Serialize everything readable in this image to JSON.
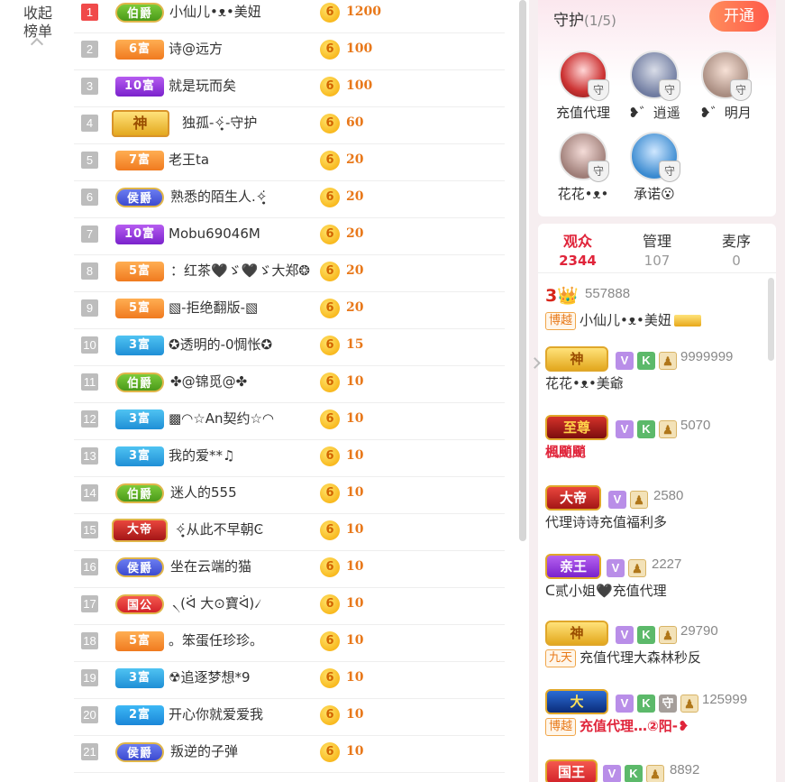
{
  "collapse": {
    "label": "收起榜单"
  },
  "ranking": [
    {
      "rank": "1",
      "badge": "伯爵",
      "name": "小仙儿•ᴥ•美妞",
      "score": "1200"
    },
    {
      "rank": "2",
      "badge": "6富",
      "name": "诗@远方",
      "score": "100"
    },
    {
      "rank": "3",
      "badge": "10富",
      "name": "就是玩而矣",
      "score": "100"
    },
    {
      "rank": "4",
      "badge": "神",
      "name": "独孤-✧̣̥̇-守护",
      "score": "60"
    },
    {
      "rank": "5",
      "badge": "7富",
      "name": "老王ta",
      "score": "20"
    },
    {
      "rank": "6",
      "badge": "侯爵",
      "name": "熟悉的陌生人.✧̣̥̇",
      "score": "20"
    },
    {
      "rank": "7",
      "badge": "10富",
      "name": "Mobu69046M",
      "score": "20"
    },
    {
      "rank": "8",
      "badge": "5富",
      "name": "：红茶🖤ゞ🖤ゞ大郑❂",
      "score": "20"
    },
    {
      "rank": "9",
      "badge": "5富",
      "name": "▧-拒绝翻版-▧",
      "score": "20"
    },
    {
      "rank": "10",
      "badge": "3富",
      "name": "✪透明的-0惆怅✪",
      "score": "15"
    },
    {
      "rank": "11",
      "badge": "伯爵",
      "name": "✤@锦觅@✤",
      "score": "10"
    },
    {
      "rank": "12",
      "badge": "3富",
      "name": "▩◠☆An契约☆◠",
      "score": "10"
    },
    {
      "rank": "13",
      "badge": "3富",
      "name": "我的爱**♫",
      "score": "10"
    },
    {
      "rank": "14",
      "badge": "伯爵",
      "name": "迷人的555",
      "score": "10"
    },
    {
      "rank": "15",
      "badge": "大帝",
      "name": "✧̣̥̇从此不早朝Ͼ",
      "score": "10"
    },
    {
      "rank": "16",
      "badge": "侯爵",
      "name": "坐在云端的猫",
      "score": "10"
    },
    {
      "rank": "17",
      "badge": "国公",
      "name": "৲(ᐛ 大⊙寶ᐛ)৴",
      "score": "10"
    },
    {
      "rank": "18",
      "badge": "5富",
      "name": "。笨蛋任珍珍。",
      "score": "10"
    },
    {
      "rank": "19",
      "badge": "3富",
      "name": "☢追逐梦想*9",
      "score": "10"
    },
    {
      "rank": "20",
      "badge": "2富",
      "name": "开心你就爱爱我",
      "score": "10"
    },
    {
      "rank": "21",
      "badge": "侯爵",
      "name": "叛逆的子弹",
      "score": "10"
    }
  ],
  "coin_glyph": "6",
  "guard": {
    "title": "守护",
    "count": "(1/5)",
    "open_label": "开通",
    "shield_glyph": "守",
    "members": [
      "充值代理",
      "❥゛逍遥",
      "❥゛明月",
      "花花•ᴥ•",
      "承诺😮"
    ]
  },
  "tabs": [
    {
      "label": "观众",
      "count": "2344"
    },
    {
      "label": "管理",
      "count": "107"
    },
    {
      "label": "麦序",
      "count": "0"
    }
  ],
  "viewers": [
    {
      "rank_glyph": "3",
      "crown_glyph": "👑",
      "num": "557888",
      "tag": "博越",
      "name": "小仙儿•ᴥ•美妞"
    },
    {
      "badge": "神",
      "num": "9999999",
      "name": "花花•ᴥ•美爺"
    },
    {
      "badge": "至尊",
      "num": "5070",
      "name": "楓颵颵"
    },
    {
      "badge": "大帝",
      "num": "2580",
      "name": "代理诗诗充值福利多"
    },
    {
      "badge": "亲王",
      "num": "2227",
      "name": "ᑕ贰小姐🖤充值代理"
    },
    {
      "badge": "神",
      "num": "29790",
      "tag": "九天",
      "name": "充值代理大森林秒反"
    },
    {
      "badge": "大",
      "num": "125999",
      "tag": "博越",
      "name": "充值代理…②阳-",
      "heart": "❥"
    },
    {
      "badge": "国王",
      "num": "8892"
    }
  ],
  "vip_icons": {
    "v": "V",
    "k": "K",
    "g": "守",
    "p": "♟"
  },
  "colors": {
    "accent": "#e0243a",
    "coin": "#f6a800",
    "score": "#e8781a",
    "open_btn": "#ff6a50"
  }
}
